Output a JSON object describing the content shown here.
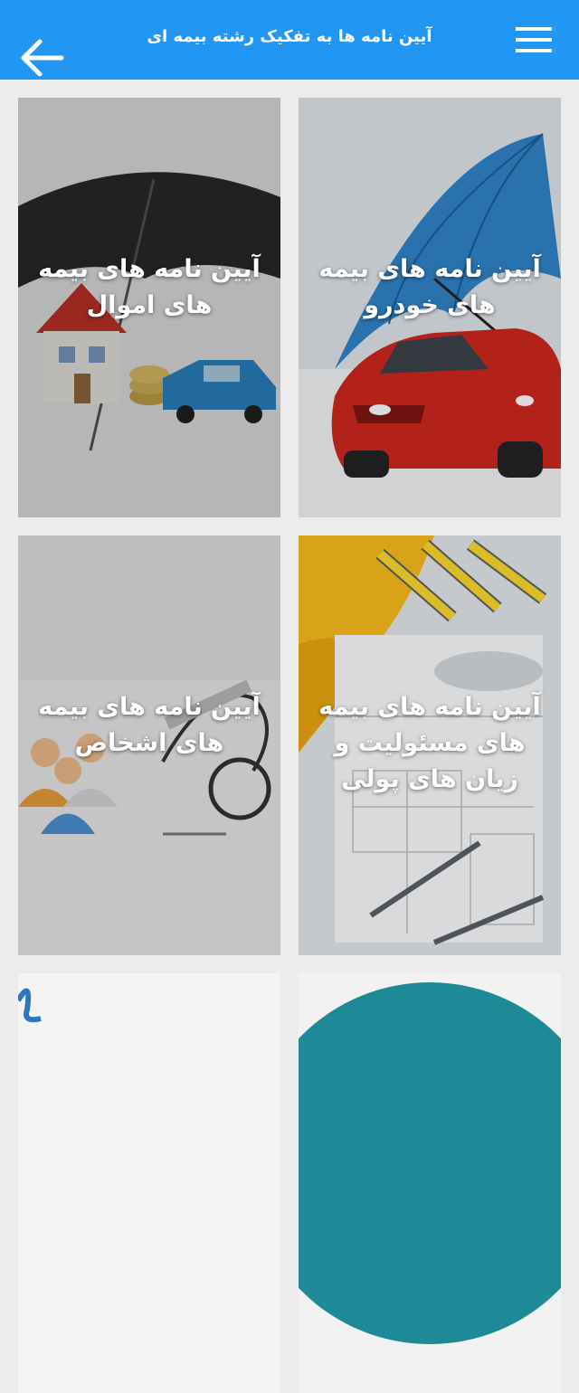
{
  "appbar": {
    "title": "آیین نامه ها به تفکیک رشته بیمه ای",
    "back_icon": "arrow-left-icon",
    "menu_icon": "hamburger-menu-icon",
    "color": "#2196F3"
  },
  "cards": [
    {
      "label": "آیین نامه های بیمه های خودرو",
      "image": "car-under-umbrella"
    },
    {
      "label": "آیین نامه های بیمه های اموال",
      "image": "house-car-coins-under-umbrella"
    },
    {
      "label": "آیین نامه های بیمه های مسئولیت و زیان های پولی",
      "image": "helmet-blueprints-tools"
    },
    {
      "label": "آیین نامه های بیمه های اشخاص",
      "image": "people-stethoscope"
    },
    {
      "label": "",
      "image": "teal-circle"
    },
    {
      "label": "",
      "image": "blue-sketch"
    }
  ]
}
